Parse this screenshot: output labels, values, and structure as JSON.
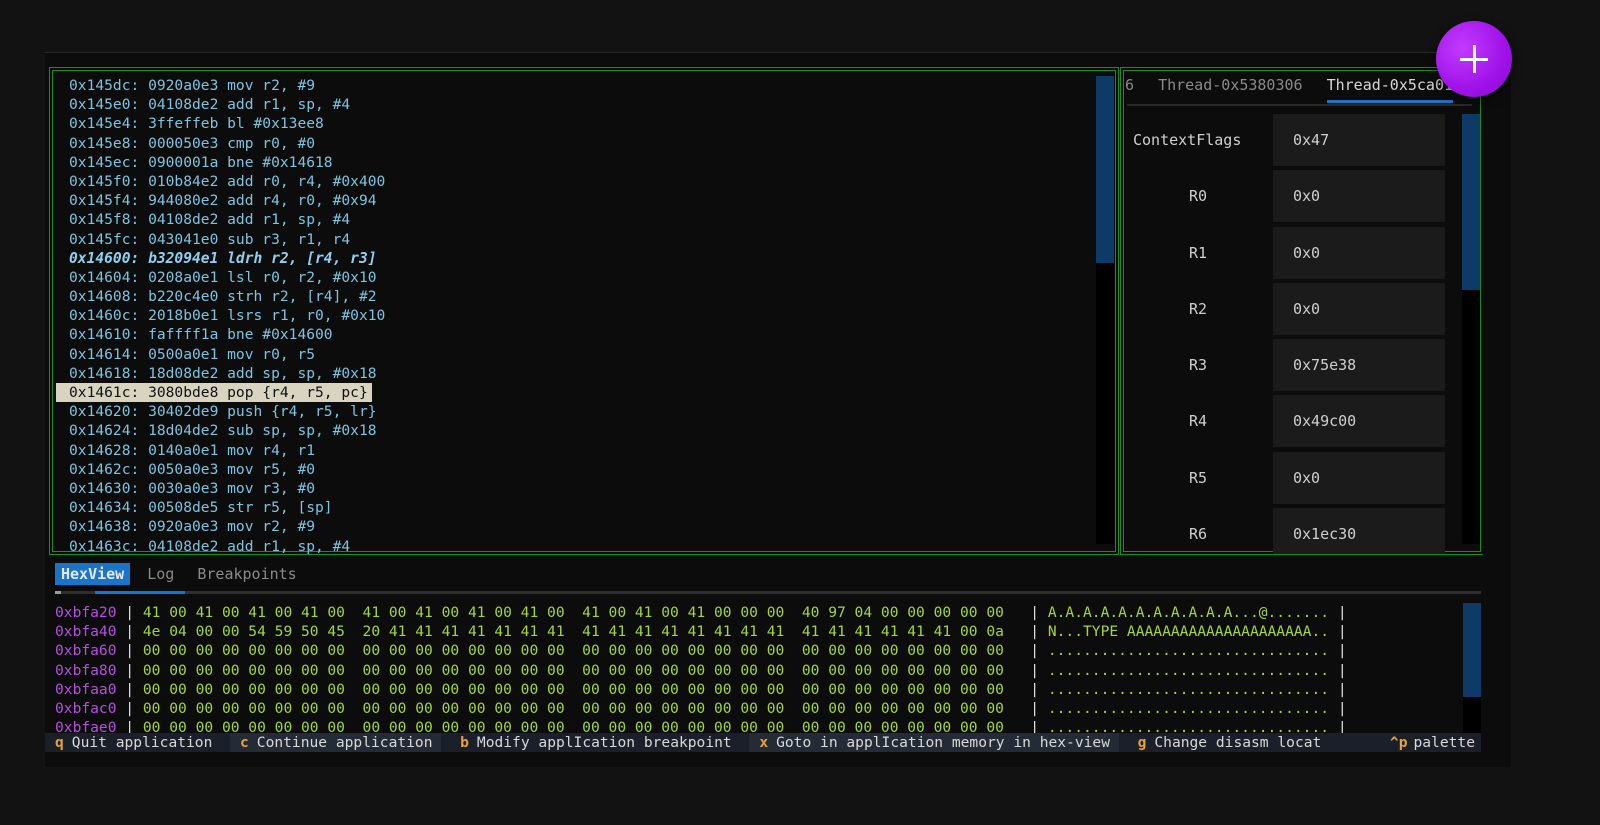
{
  "disassembly": {
    "lines": [
      "0x145dc: 0920a0e3 mov r2, #9",
      "0x145e0: 04108de2 add r1, sp, #4",
      "0x145e4: 3ffeffeb bl #0x13ee8",
      "0x145e8: 000050e3 cmp r0, #0",
      "0x145ec: 0900001a bne #0x14618",
      "0x145f0: 010b84e2 add r0, r4, #0x400",
      "0x145f4: 944080e2 add r4, r0, #0x94",
      "0x145f8: 04108de2 add r1, sp, #4",
      "0x145fc: 043041e0 sub r3, r1, r4",
      "0x14600: b32094e1 ldrh r2, [r4, r3]",
      "0x14604: 0208a0e1 lsl r0, r2, #0x10",
      "0x14608: b220c4e0 strh r2, [r4], #2",
      "0x1460c: 2018b0e1 lsrs r1, r0, #0x10",
      "0x14610: faffff1a bne #0x14600",
      "0x14614: 0500a0e1 mov r0, r5",
      "0x14618: 18d08de2 add sp, sp, #0x18",
      "0x1461c: 3080bde8 pop {r4, r5, pc}",
      "0x14620: 30402de9 push {r4, r5, lr}",
      "0x14624: 18d04de2 sub sp, sp, #0x18",
      "0x14628: 0140a0e1 mov r4, r1",
      "0x1462c: 0050a0e3 mov r5, #0",
      "0x14630: 0030a0e3 mov r3, #0",
      "0x14634: 00508de5 str r5, [sp]",
      "0x14638: 0920a0e3 mov r2, #9",
      "0x1463c: 04108de2 add r1, sp, #4"
    ],
    "bold_index": 9,
    "selected_index": 16,
    "scroll_fraction": 0.4
  },
  "threads": {
    "tabs": [
      "6",
      "Thread-0x5380306",
      "Thread-0x5ca01"
    ],
    "active_tab_index": 2,
    "registers": [
      {
        "name": "ContextFlags",
        "value": "0x47"
      },
      {
        "name": "R0",
        "value": "0x0"
      },
      {
        "name": "R1",
        "value": "0x0"
      },
      {
        "name": "R2",
        "value": "0x0"
      },
      {
        "name": "R3",
        "value": "0x75e38"
      },
      {
        "name": "R4",
        "value": "0x49c00"
      },
      {
        "name": "R5",
        "value": "0x0"
      },
      {
        "name": "R6",
        "value": "0x1ec30"
      }
    ]
  },
  "bottom_tabs": [
    "HexView",
    "Log",
    "Breakpoints"
  ],
  "hexview": {
    "rows": [
      {
        "addr": "0xbfa20",
        "bytes": "41 00 41 00 41 00 41 00  41 00 41 00 41 00 41 00  41 00 41 00 41 00 00 00  40 97 04 00 00 00 00 00",
        "ascii": "A.A.A.A.A.A.A.A.A.A.A...@......."
      },
      {
        "addr": "0xbfa40",
        "bytes": "4e 04 00 00 54 59 50 45  20 41 41 41 41 41 41 41  41 41 41 41 41 41 41 41  41 41 41 41 41 41 00 0a",
        "ascii": "N...TYPE AAAAAAAAAAAAAAAAAAAAA.."
      },
      {
        "addr": "0xbfa60",
        "bytes": "00 00 00 00 00 00 00 00  00 00 00 00 00 00 00 00  00 00 00 00 00 00 00 00  00 00 00 00 00 00 00 00",
        "ascii": "................................"
      },
      {
        "addr": "0xbfa80",
        "bytes": "00 00 00 00 00 00 00 00  00 00 00 00 00 00 00 00  00 00 00 00 00 00 00 00  00 00 00 00 00 00 00 00",
        "ascii": "................................"
      },
      {
        "addr": "0xbfaa0",
        "bytes": "00 00 00 00 00 00 00 00  00 00 00 00 00 00 00 00  00 00 00 00 00 00 00 00  00 00 00 00 00 00 00 00",
        "ascii": "................................"
      },
      {
        "addr": "0xbfac0",
        "bytes": "00 00 00 00 00 00 00 00  00 00 00 00 00 00 00 00  00 00 00 00 00 00 00 00  00 00 00 00 00 00 00 00",
        "ascii": "................................"
      },
      {
        "addr": "0xbfae0",
        "bytes": "00 00 00 00 00 00 00 00  00 00 00 00 00 00 00 00  00 00 00 00 00 00 00 00  00 00 00 00 00 00 00 00",
        "ascii": "................................"
      }
    ]
  },
  "statusbar": {
    "items": [
      {
        "key": "q",
        "label": "Quit application"
      },
      {
        "key": "c",
        "label": "Continue application"
      },
      {
        "key": "b",
        "label": "Modify applIcation breakpoint"
      },
      {
        "key": "x",
        "label": "Goto in applIcation memory in hex-view"
      },
      {
        "key": "g",
        "label": "Change disasm locat"
      }
    ],
    "palette_key": "^p",
    "palette_label": "palette"
  },
  "colors": {
    "pane_border": "#1a8f1a",
    "accent": "#1a74c9",
    "address": "#b64fe0",
    "hex_bytes": "#a3d63b",
    "disasm_text": "#7ec3e0",
    "fab": "#a012e8"
  },
  "fab": {
    "icon": "plus-icon"
  }
}
